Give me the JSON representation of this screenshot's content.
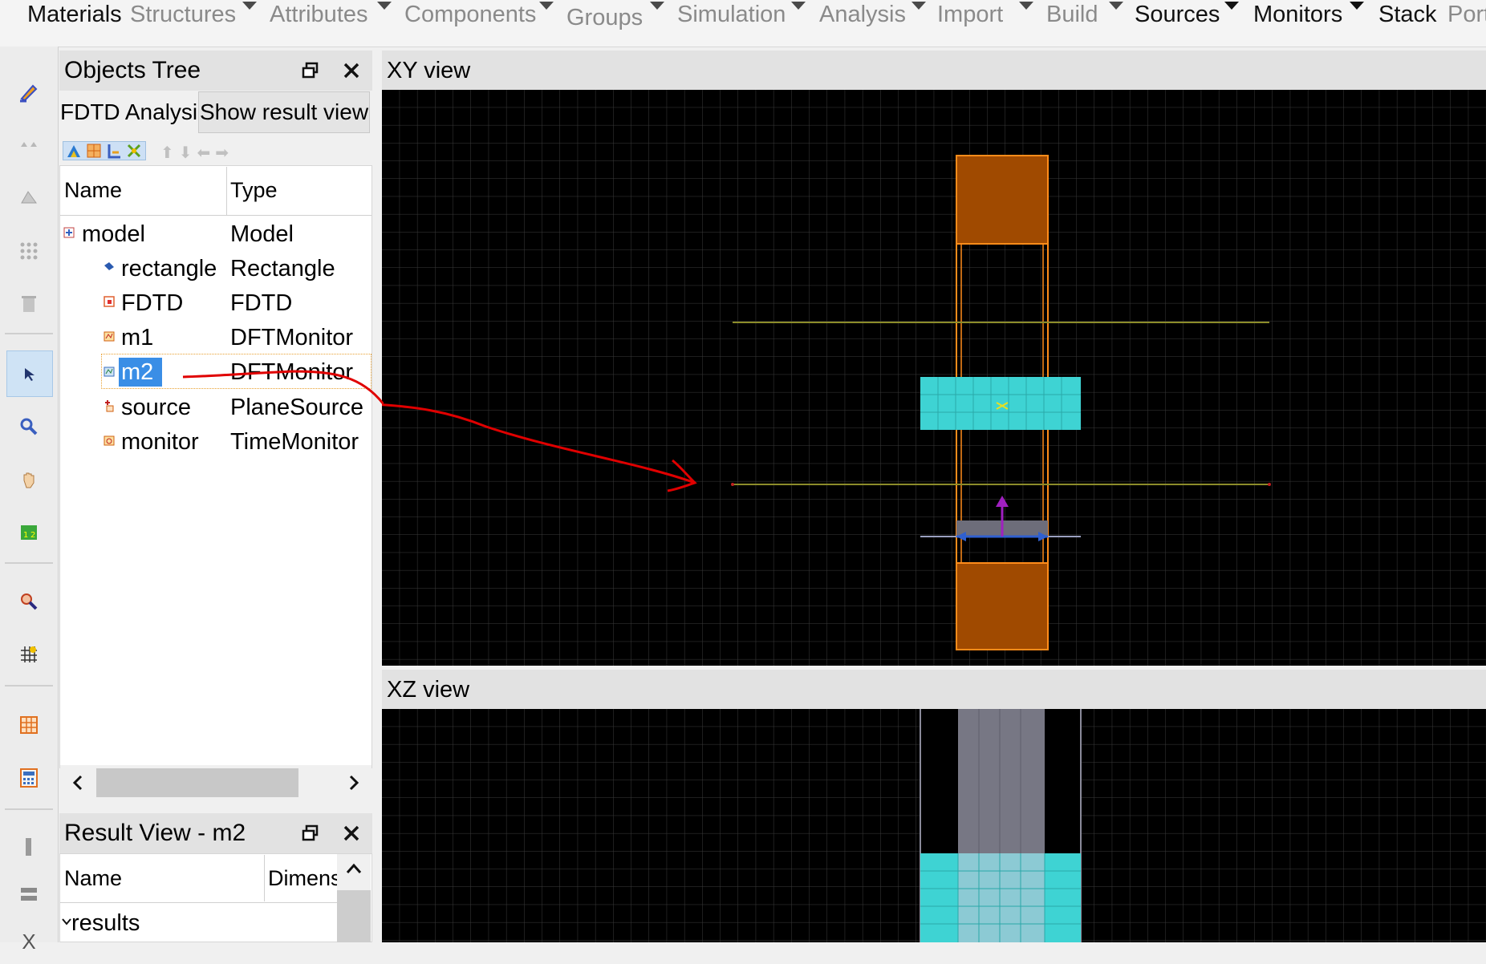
{
  "menu": {
    "items": [
      "Materials",
      "Structures",
      "Attributes",
      "Components",
      "Groups",
      "Simulation",
      "Analysis",
      "Import",
      "Build",
      "Sources",
      "Monitors",
      "Stack",
      "Port"
    ]
  },
  "toolbar": {
    "icons": [
      "edit-icon",
      "dots-icon",
      "triangle-icon",
      "grid-dots-icon",
      "trash-icon",
      "select-pointer-icon",
      "zoom-icon",
      "pan-hand-icon",
      "ruler-icon",
      "zoom-region-icon",
      "grid-snap-icon",
      "table-icon",
      "calculator-icon",
      "bar-icon",
      "bars-icon",
      "x-icon"
    ],
    "bottom_label": "X"
  },
  "objects_tree": {
    "title": "Objects Tree",
    "analysis_label": "FDTD Analysis",
    "show_result_button": "Show result view",
    "columns": [
      "Name",
      "Type"
    ],
    "rows": [
      {
        "name": "model",
        "type": "Model",
        "icon": "model-icon"
      },
      {
        "name": "rectangle",
        "type": "Rectangle",
        "icon": "rectangle-icon"
      },
      {
        "name": "FDTD",
        "type": "FDTD",
        "icon": "fdtd-icon"
      },
      {
        "name": "m1",
        "type": "DFTMonitor",
        "icon": "dft-monitor-icon"
      },
      {
        "name": "m2",
        "type": "DFTMonitor",
        "icon": "dft-monitor-icon",
        "selected": true
      },
      {
        "name": "source",
        "type": "PlaneSource",
        "icon": "plane-source-icon"
      },
      {
        "name": "monitor",
        "type": "TimeMonitor",
        "icon": "time-monitor-icon"
      }
    ]
  },
  "result_view": {
    "title": "Result View - m2",
    "columns": [
      "Name",
      "Dimens"
    ],
    "rows": [
      {
        "name": "results"
      }
    ]
  },
  "xy_view": {
    "title": "XY view"
  },
  "xz_view": {
    "title": "XZ view"
  },
  "colors": {
    "accent_selection": "#3a8ee6",
    "structure_orange": "#a04a00",
    "structure_outline": "#ff8c1a",
    "monitor_cyan": "#3ed3d3",
    "monitor_line": "#8c8c2a",
    "annotation_red": "#e00000",
    "source_arrow": "#a020c0"
  }
}
